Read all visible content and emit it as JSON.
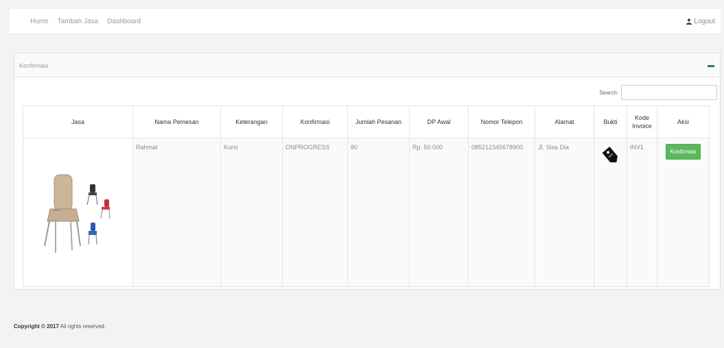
{
  "nav": {
    "items": [
      {
        "label": "Home"
      },
      {
        "label": "Tambah Jasa"
      },
      {
        "label": "Dashboard"
      }
    ],
    "logout_label": "Logout"
  },
  "panel": {
    "title": "Konfirmasi"
  },
  "search": {
    "label": "Search:",
    "value": "",
    "placeholder": ""
  },
  "table": {
    "headers": [
      "Jasa",
      "Nama Pemesan",
      "Keterangan",
      "Konfirmasi",
      "Jumlah Pesanan",
      "DP Awal",
      "Nomor Telepon",
      "Alamat",
      "Bukti",
      "Kode Invoice",
      "Aksi"
    ],
    "rows": [
      {
        "jasa_image": "chair-product-image",
        "nama_pemesan": "Rahmat",
        "keterangan": "Kursi",
        "konfirmasi": "ONPROGRESS",
        "jumlah_pesanan": "80",
        "dp_awal": "Rp. 50.000",
        "nomor_telepon": "085212345678900",
        "alamat": "Jl. Sisa Dia",
        "bukti_icon": "price-tag-icon",
        "kode_invoice": "INV1",
        "aksi_label": "Konfirmasi"
      }
    ]
  },
  "footer": {
    "copyright": "Copyright © 2017",
    "rights": "All rights reserved."
  },
  "colors": {
    "accent_button": "#5cb85c",
    "minimize_bar": "#2f6f7e",
    "background": "#f3f3f3"
  }
}
